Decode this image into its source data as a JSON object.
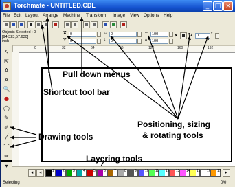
{
  "window": {
    "title": "Torchmate - UNTITLED.CDL"
  },
  "menu": {
    "items": [
      "File",
      "Edit",
      "Layout",
      "Arrange",
      "Machine",
      "Transform",
      "Image",
      "View",
      "Options",
      "Help"
    ]
  },
  "properties": {
    "objects_selected": "Objects Selected : 0",
    "position": "[94.323,57.630]",
    "units": "inch",
    "x_label": "X",
    "y_label": "Y",
    "x_value": "0",
    "y_value": "0",
    "w_value": "0",
    "h_value": "0",
    "scale_w": "100",
    "scale_h": "100",
    "rotation_value": "0",
    "rotation_unit": "°"
  },
  "ruler": {
    "ticks": [
      "0",
      "32",
      "64",
      "96",
      "128",
      "160",
      "192"
    ]
  },
  "annotations": {
    "pull_down_menus": "Pull down menus",
    "shortcut_tool_bar": "Shortcut tool bar",
    "drawing_tools": "Drawing tools",
    "positioning": "Positioning, sizing",
    "rotating": "& rotating tools",
    "layering_tools": "Layering tools"
  },
  "layers": {
    "tabs": [
      "1",
      "2",
      "3",
      "4",
      "5",
      "6",
      "7",
      "8",
      "9",
      "10",
      "11",
      "12",
      "13",
      "14",
      "15",
      "16",
      "17"
    ],
    "colors": [
      "#000000",
      "#0000cc",
      "#00aa00",
      "#00aaaa",
      "#cc0000",
      "#aa00aa",
      "#aa6600",
      "#aaaaaa",
      "#555555",
      "#5555ff",
      "#55ff55",
      "#55ffff",
      "#ff5555",
      "#ff55ff",
      "#ffff55",
      "#ffffff",
      "#ff9900"
    ]
  },
  "status": {
    "left": "Selecting",
    "right": "0/0"
  }
}
